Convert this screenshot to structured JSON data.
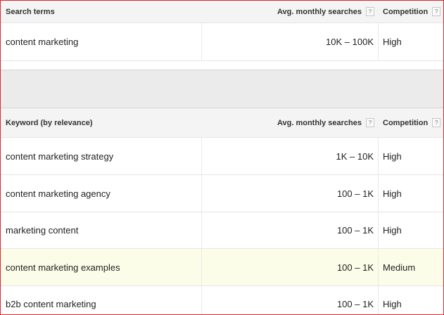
{
  "search_table": {
    "header": {
      "col1": "Search terms",
      "col2": "Avg. monthly searches",
      "col3": "Competition",
      "help_glyph": "?"
    },
    "rows": [
      {
        "term": "content marketing",
        "searches": "10K – 100K",
        "competition": "High"
      }
    ]
  },
  "keyword_table": {
    "header": {
      "col1": "Keyword (by relevance)",
      "col2": "Avg. monthly searches",
      "col3": "Competition",
      "help_glyph": "?"
    },
    "rows": [
      {
        "term": "content marketing strategy",
        "searches": "1K – 10K",
        "competition": "High"
      },
      {
        "term": "content marketing agency",
        "searches": "100 – 1K",
        "competition": "High"
      },
      {
        "term": "marketing content",
        "searches": "100 – 1K",
        "competition": "High"
      },
      {
        "term": "content marketing examples",
        "searches": "100 – 1K",
        "competition": "Medium"
      },
      {
        "term": "b2b content marketing",
        "searches": "100 – 1K",
        "competition": "High"
      }
    ]
  },
  "colors": {
    "border_accent": "#e0242c",
    "header_bg": "#f4f4f4",
    "highlight_row": "#fcfde9",
    "separator_band": "#ebebeb"
  }
}
